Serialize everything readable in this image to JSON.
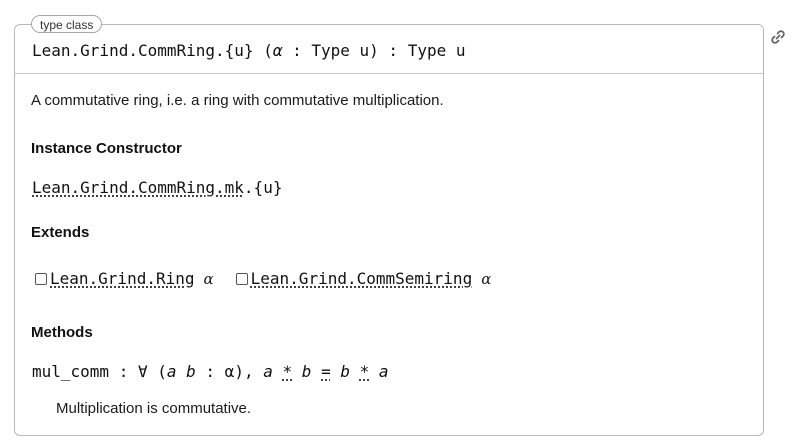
{
  "kind_badge": "type class",
  "signature": {
    "name": "Lean.Grind.CommRing.{u}",
    "open_paren": " (",
    "param": "α",
    "param_type": " : Type u)",
    "result": " : Type u"
  },
  "docstring": "A commutative ring, i.e. a ring with commutative multiplication.",
  "instance_constructor": {
    "heading": "Instance Constructor",
    "name": "Lean.Grind.CommRing.mk",
    "universe": ".{u}"
  },
  "extends": {
    "heading": "Extends",
    "items": [
      {
        "name": "Lean.Grind.Ring",
        "arg": "α"
      },
      {
        "name": "Lean.Grind.CommSemiring",
        "arg": "α"
      }
    ]
  },
  "methods": {
    "heading": "Methods",
    "items": [
      {
        "name": "mul_comm",
        "colon": " : ∀ (",
        "binder_a": "a",
        "binder_b": "b",
        "binder_type": " : α), ",
        "lhs_a": "a",
        "op1": "*",
        "lhs_b": "b",
        "eq": "=",
        "rhs_b": "b",
        "op2": "*",
        "rhs_a": "a",
        "doc": "Multiplication is commutative."
      }
    ]
  },
  "icons": {
    "permalink": "link-icon"
  }
}
